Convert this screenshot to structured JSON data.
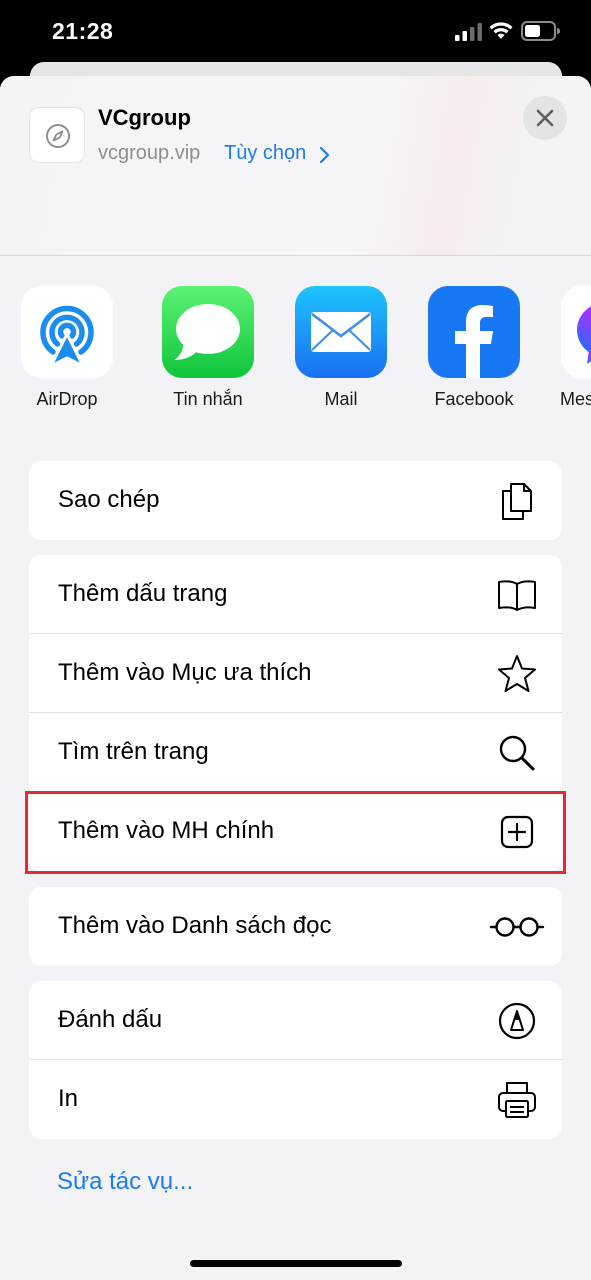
{
  "status_bar": {
    "time": "21:28",
    "signal_icon": "cellular-signal-icon",
    "wifi_icon": "wifi-icon",
    "battery_icon": "battery-icon"
  },
  "share_header": {
    "title": "VCgroup",
    "url": "vcgroup.vip",
    "options_label": "Tùy chọn",
    "site_icon": "compass-icon",
    "close_icon": "close-icon"
  },
  "apps": [
    {
      "label": "AirDrop",
      "icon": "airdrop-icon"
    },
    {
      "label": "Tin nhắn",
      "icon": "messages-icon"
    },
    {
      "label": "Mail",
      "icon": "mail-icon"
    },
    {
      "label": "Facebook",
      "icon": "facebook-icon"
    },
    {
      "label": "Mes",
      "icon": "messenger-icon"
    }
  ],
  "actions": {
    "copy": {
      "label": "Sao chép",
      "icon": "copy-icon"
    },
    "add_bookmark": {
      "label": "Thêm dấu trang",
      "icon": "book-icon"
    },
    "add_favorites": {
      "label": "Thêm vào Mục ưa thích",
      "icon": "star-icon"
    },
    "find_on_page": {
      "label": "Tìm trên trang",
      "icon": "search-icon"
    },
    "add_home_screen": {
      "label": "Thêm vào MH chính",
      "icon": "plus-square-icon"
    },
    "add_reading_list": {
      "label": "Thêm vào Danh sách đọc",
      "icon": "glasses-icon"
    },
    "markup": {
      "label": "Đánh dấu",
      "icon": "markup-pen-icon"
    },
    "print": {
      "label": "In",
      "icon": "printer-icon"
    }
  },
  "edit_actions_label": "Sửa tác vụ...",
  "colors": {
    "accent": "#1a7cf5",
    "highlight": "#e12b37",
    "sheet_background": "#f2f2f7"
  }
}
